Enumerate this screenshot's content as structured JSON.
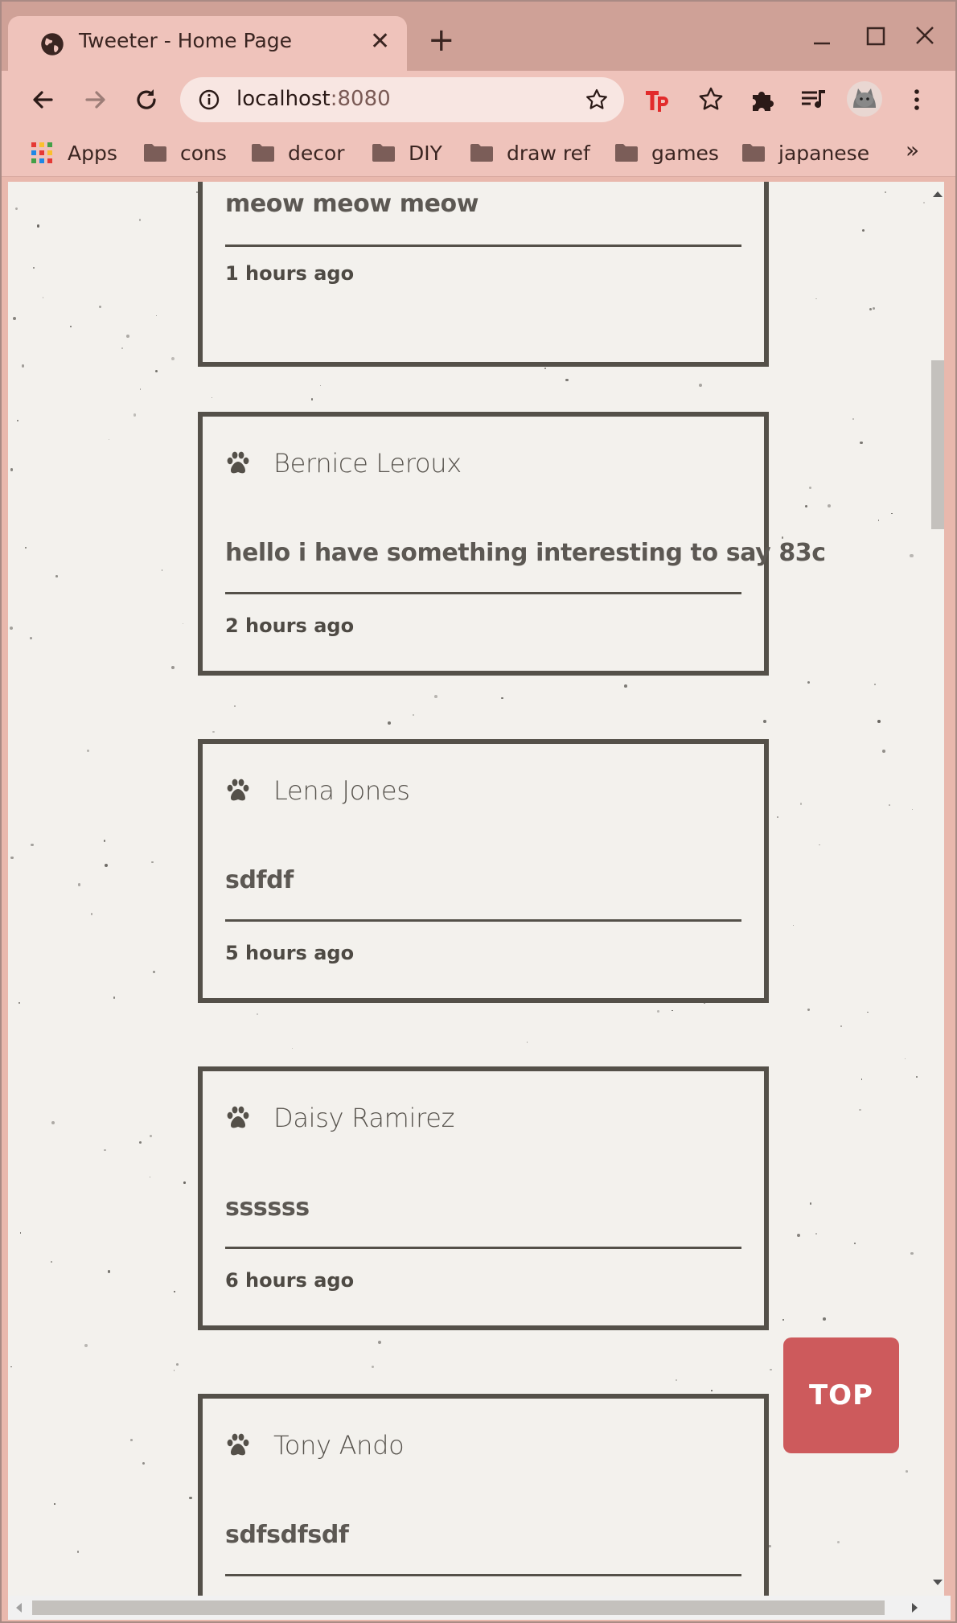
{
  "browser": {
    "tab_title": "Tweeter - Home Page",
    "tab_close": "✕",
    "new_tab": "+",
    "url_host": "localhost",
    "url_port": ":8080"
  },
  "bookmarks": {
    "items": [
      {
        "label": "Apps"
      },
      {
        "label": "cons"
      },
      {
        "label": "decor"
      },
      {
        "label": "DIY"
      },
      {
        "label": "draw ref"
      },
      {
        "label": "games"
      },
      {
        "label": "japanese"
      }
    ],
    "more": "»"
  },
  "tweets": [
    {
      "author": "",
      "text": "meow meow meow",
      "time": "1 hours ago"
    },
    {
      "author": "Bernice Leroux",
      "text": "hello i have something interesting to say 83c",
      "time": "2 hours ago"
    },
    {
      "author": "Lena Jones",
      "text": "sdfdf",
      "time": "5 hours ago"
    },
    {
      "author": "Daisy Ramirez",
      "text": "ssssss",
      "time": "6 hours ago"
    },
    {
      "author": "Tony Ando",
      "text": "sdfsdfsdf",
      "time": ""
    }
  ],
  "top_button": {
    "label": "TOP"
  },
  "colors": {
    "titlebar": "#cfa197",
    "toolbar": "#efc3bb",
    "page_bg": "#f3f1ed",
    "card_border": "#545049",
    "top_button": "#cd5a5c"
  }
}
